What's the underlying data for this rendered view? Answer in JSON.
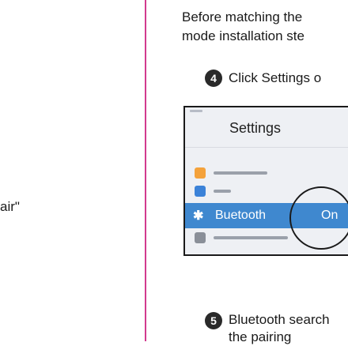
{
  "left_column": {
    "fragment": "air\""
  },
  "right_column": {
    "intro_lines": [
      "Before matching the",
      "mode installation ste"
    ],
    "steps": [
      {
        "number": "4",
        "text": "Click Settings o"
      },
      {
        "number": "5",
        "lines": [
          "Bluetooth search",
          "the pairing"
        ]
      }
    ]
  },
  "phone_screen": {
    "title": "Settings",
    "bluetooth_row": {
      "icon": "bluetooth-icon",
      "glyph": "✱",
      "label": "Buetooth",
      "value": "On"
    },
    "colors": {
      "highlight": "#3f88cf",
      "airplane_icon": "#f4a23b",
      "wlan_icon": "#3b82d8",
      "notification_icon": "#8a8f98"
    }
  },
  "colors": {
    "column_rule": "#d23a8e"
  }
}
